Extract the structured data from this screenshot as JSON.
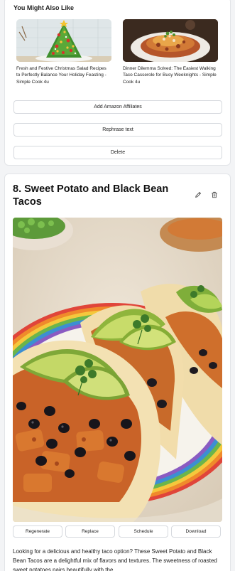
{
  "related": {
    "title": "You Might Also Like",
    "items": [
      {
        "caption": "Fresh and Festive Christmas Salad Recipes to Perfectly Balance Your Holiday Feasting - Simple Cook 4u"
      },
      {
        "caption": "Dinner Dilemma Solved: The Easiest Walking Taco Casserole for Busy Weeknights - Simple Cook 4u"
      }
    ]
  },
  "actions": {
    "affiliates_label": "Add Amazon Affiliates",
    "rephrase_label": "Rephrase text",
    "delete_label": "Delete"
  },
  "recipe": {
    "title": "8. Sweet Potato and Black Bean Tacos",
    "image_buttons": {
      "regenerate": "Regenerate",
      "replace": "Replace",
      "schedule": "Schedule",
      "download": "Download"
    },
    "description": "Looking for a delicious and healthy taco option? These Sweet Potato and Black Bean Tacos are a delightful mix of flavors and textures. The sweetness of roasted sweet potatoes pairs beautifully with the"
  },
  "icons": {
    "edit": "pencil-icon",
    "delete": "trash-icon"
  }
}
